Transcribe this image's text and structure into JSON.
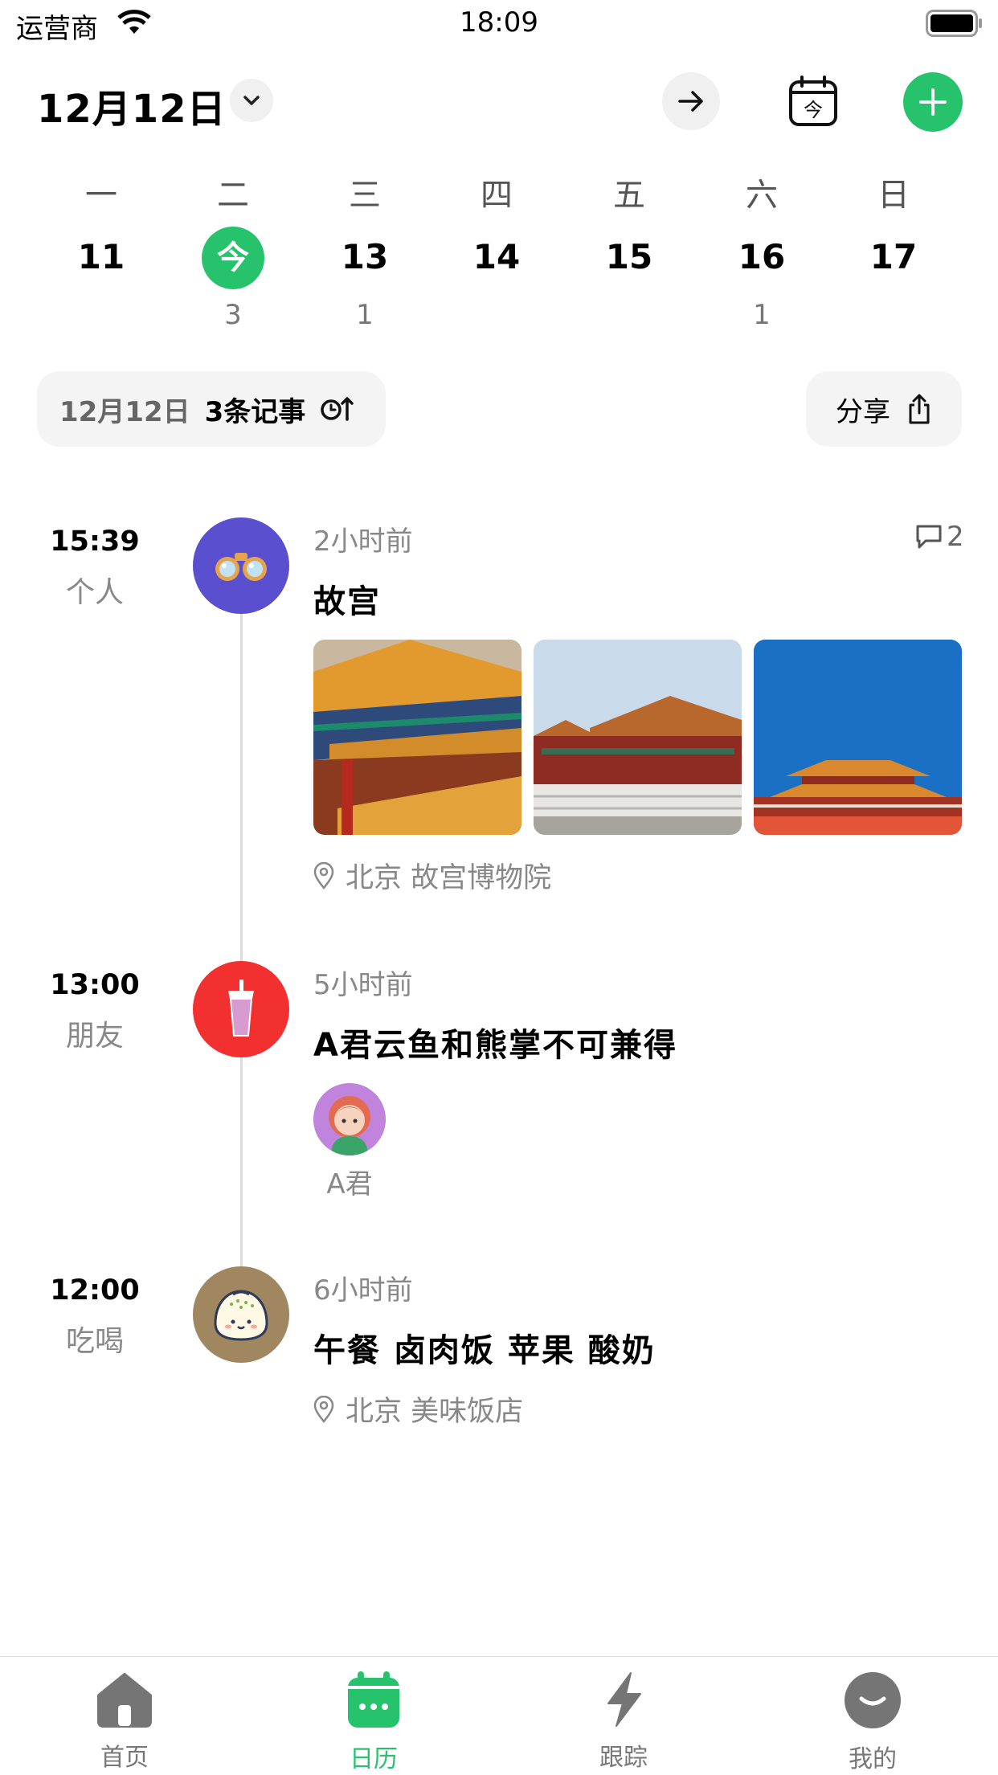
{
  "status_bar": {
    "carrier": "运营商",
    "time": "18:09"
  },
  "header": {
    "date": "12月12日"
  },
  "week": {
    "days": [
      {
        "weekday": "一",
        "date": "11",
        "count": ""
      },
      {
        "weekday": "二",
        "date": "今",
        "count": "3",
        "today": true
      },
      {
        "weekday": "三",
        "date": "13",
        "count": "1"
      },
      {
        "weekday": "四",
        "date": "14",
        "count": ""
      },
      {
        "weekday": "五",
        "date": "15",
        "count": ""
      },
      {
        "weekday": "六",
        "date": "16",
        "count": "1"
      },
      {
        "weekday": "日",
        "date": "17",
        "count": ""
      }
    ]
  },
  "summary": {
    "date": "12月12日",
    "count": "3条记事",
    "share_label": "分享"
  },
  "events": [
    {
      "time": "15:39",
      "category": "个人",
      "ago": "2小时前",
      "title": "故宫",
      "comments": "2",
      "location": "北京 故宫博物院",
      "icon": "binoculars-icon",
      "icon_bg": "#5a4fcf"
    },
    {
      "time": "13:00",
      "category": "朋友",
      "ago": "5小时前",
      "title": "A君云鱼和熊掌不可兼得",
      "person": "A君",
      "icon": "drink-cup-icon",
      "icon_bg": "#f2302f"
    },
    {
      "time": "12:00",
      "category": "吃喝",
      "ago": "6小时前",
      "title": "午餐 卤肉饭 苹果 酸奶",
      "location": "北京 美味饭店",
      "icon": "bun-icon",
      "icon_bg": "#a0875f"
    }
  ],
  "tabs": [
    {
      "label": "首页",
      "icon": "home-icon"
    },
    {
      "label": "日历",
      "icon": "calendar-icon",
      "active": true
    },
    {
      "label": "跟踪",
      "icon": "lightning-icon"
    },
    {
      "label": "我的",
      "icon": "smile-icon"
    }
  ],
  "colors": {
    "accent": "#27c26c"
  }
}
